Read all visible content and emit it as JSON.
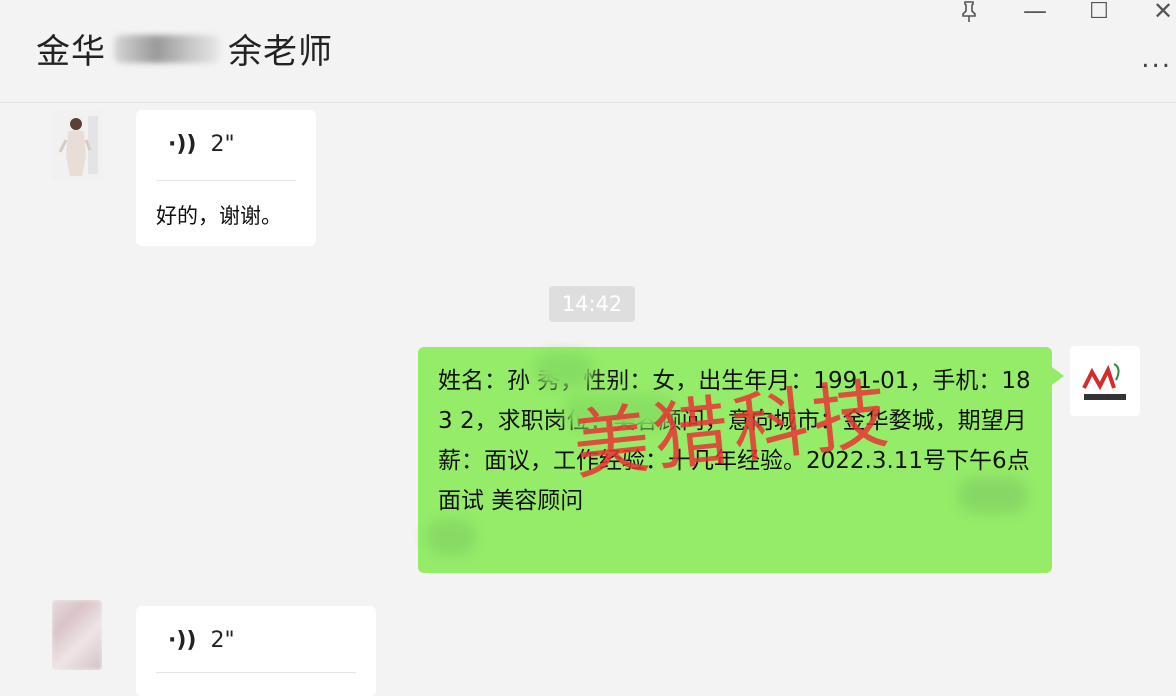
{
  "chat": {
    "title_prefix": "金华",
    "title_suffix": "余老师",
    "more_label": "..."
  },
  "window_controls": {
    "pin_icon": "pin-icon",
    "minimize_label": "—",
    "maximize_label": "☐",
    "close_label": "✕"
  },
  "messages": {
    "voice1": {
      "duration": "2\"",
      "transcript": "好的，谢谢。"
    },
    "timestamp": "14:42",
    "resume_text": "姓名：孙  秀，性别：女，出生年月：1991-01，手机：183         2，求职岗位：美容顾问，意向城市：金华婺城，期望月薪：面议，工作经验：十几年经验。2022.3.11号下午6点面试     美容顾问",
    "voice2": {
      "duration": "2\""
    }
  },
  "avatar_right": {
    "logo_text": "美猎科技"
  },
  "watermark": {
    "text": "美猎科技",
    "color": "#e83434"
  },
  "colors": {
    "green_bubble": "#95ec69",
    "background": "#f3f3f3"
  }
}
